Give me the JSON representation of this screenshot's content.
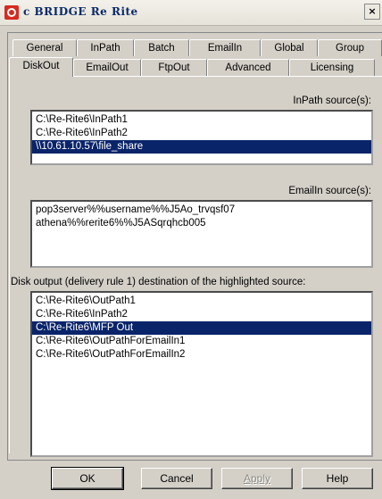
{
  "window": {
    "title": "c BRIDGE Re Rite",
    "close": "×"
  },
  "tabs_row1": [
    "General",
    "InPath",
    "Batch",
    "EmailIn",
    "Global",
    "Group"
  ],
  "tabs_row2": [
    "DiskOut",
    "EmailOut",
    "FtpOut",
    "Advanced",
    "Licensing"
  ],
  "active_tab": "DiskOut",
  "inpath": {
    "label": "InPath source(s):",
    "items": [
      "C:\\Re-Rite6\\InPath1",
      "C:\\Re-Rite6\\InPath2",
      "\\\\10.61.10.57\\file_share"
    ],
    "selected_index": 2
  },
  "emailin": {
    "label": "EmailIn source(s):",
    "items": [
      "pop3server%%username%%J5Ao_trvqsf07",
      "athena%%rerite6%%J5ASqrqhcb005"
    ]
  },
  "diskout": {
    "label": "Disk output (delivery rule 1) destination of the highlighted source:",
    "items": [
      "C:\\Re-Rite6\\OutPath1",
      "C:\\Re-Rite6\\InPath2",
      "C:\\Re-Rite6\\MFP Out",
      "C:\\Re-Rite6\\OutPathForEmailIn1",
      "C:\\Re-Rite6\\OutPathForEmailIn2"
    ],
    "selected_index": 2
  },
  "buttons": {
    "ok": "OK",
    "cancel": "Cancel",
    "apply": "Apply",
    "help": "Help"
  }
}
